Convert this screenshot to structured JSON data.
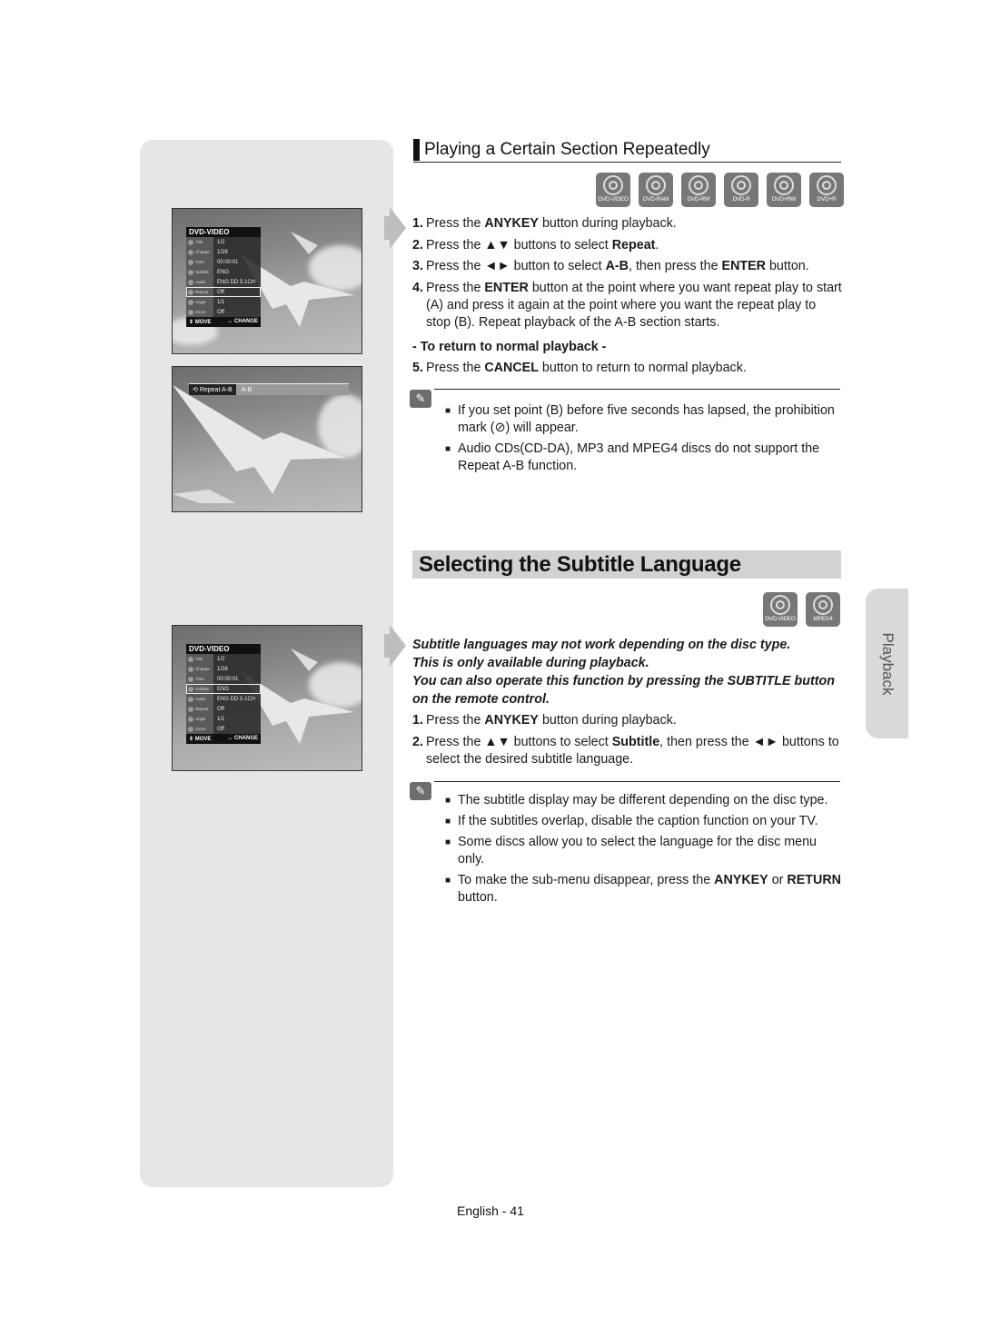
{
  "section1": {
    "title": "Playing a Certain Section Repeatedly",
    "discs": [
      "DVD-VIDEO",
      "DVD-RAM",
      "DVD-RW",
      "DVD-R",
      "DVD+RW",
      "DVD+R"
    ],
    "steps": [
      {
        "num": "1.",
        "pre": "Press the ",
        "b1": "ANYKEY",
        "mid": " button during playback.",
        "b2": "",
        "post": ""
      },
      {
        "num": "2.",
        "pre": "Press the ▲▼ buttons to select ",
        "b1": "Repeat",
        "mid": ".",
        "b2": "",
        "post": ""
      },
      {
        "num": "3.",
        "pre": "Press the ◄► button to select ",
        "b1": "A-B",
        "mid": ", then press the ",
        "b2": "ENTER",
        "post": " button."
      },
      {
        "num": "4.",
        "pre": "Press the ",
        "b1": "ENTER",
        "mid": " button at the point where you want repeat play to start (A) and press it again at the point where you want the repeat play to stop (B). Repeat playback of the A-B section starts.",
        "b2": "",
        "post": ""
      }
    ],
    "return_heading": "- To return to normal playback -",
    "step5": {
      "num": "5.",
      "pre": "Press the ",
      "b1": "CANCEL",
      "mid": " button to return to normal playback."
    },
    "notes": [
      "If you set point (B) before five seconds has lapsed, the prohibition mark (⊘) will appear.",
      "Audio CDs(CD-DA), MP3 and MPEG4 discs do not support the Repeat A-B function."
    ]
  },
  "section2": {
    "title": "Selecting the Subtitle Language",
    "discs": [
      "DVD-VIDEO",
      "MPEG4"
    ],
    "intro": [
      "Subtitle languages may not work depending on the disc type.",
      "This is only available during playback.",
      "You can also operate this function by pressing the SUBTITLE button on the remote control."
    ],
    "steps": [
      {
        "num": "1.",
        "pre": "Press the ",
        "b1": "ANYKEY",
        "mid": " button during playback.",
        "b2": "",
        "post": ""
      },
      {
        "num": "2.",
        "pre": "Press the ▲▼ buttons to select ",
        "b1": "Subtitle",
        "mid": ", then press the ◄► buttons to select the desired subtitle language.",
        "b2": "",
        "post": ""
      }
    ],
    "notes": [
      {
        "pre": "The subtitle display may be different depending on the disc type.",
        "b1": "",
        "mid": "",
        "b2": "",
        "post": ""
      },
      {
        "pre": "If the subtitles overlap, disable the caption function on your TV.",
        "b1": "",
        "mid": "",
        "b2": "",
        "post": ""
      },
      {
        "pre": "Some discs allow you to select the language for the disc menu only.",
        "b1": "",
        "mid": "",
        "b2": "",
        "post": ""
      },
      {
        "pre": "To make the sub-menu disappear, press the ",
        "b1": "ANYKEY",
        "mid": " or ",
        "b2": "RETURN",
        "post": " button."
      }
    ]
  },
  "osd": {
    "title": "DVD-VIDEO",
    "rows": [
      {
        "label": "Title",
        "value": "1/2"
      },
      {
        "label": "Chapter",
        "value": "1/28"
      },
      {
        "label": "Time",
        "value": "00:00:01"
      },
      {
        "label": "Subtitle",
        "value": "ENG"
      },
      {
        "label": "Audio",
        "value": "ENG DD 5.1CH"
      },
      {
        "label": "Repeat",
        "value": "Off"
      },
      {
        "label": "Angle",
        "value": "1/1"
      },
      {
        "label": "Zoom",
        "value": "Off"
      }
    ],
    "footer_move": "⇕ MOVE",
    "footer_change": "↔ CHANGE"
  },
  "repeat_bar": {
    "label": "Repeat A-B",
    "value": "A-B"
  },
  "side_tab": "Playback",
  "footer": "English - 41"
}
